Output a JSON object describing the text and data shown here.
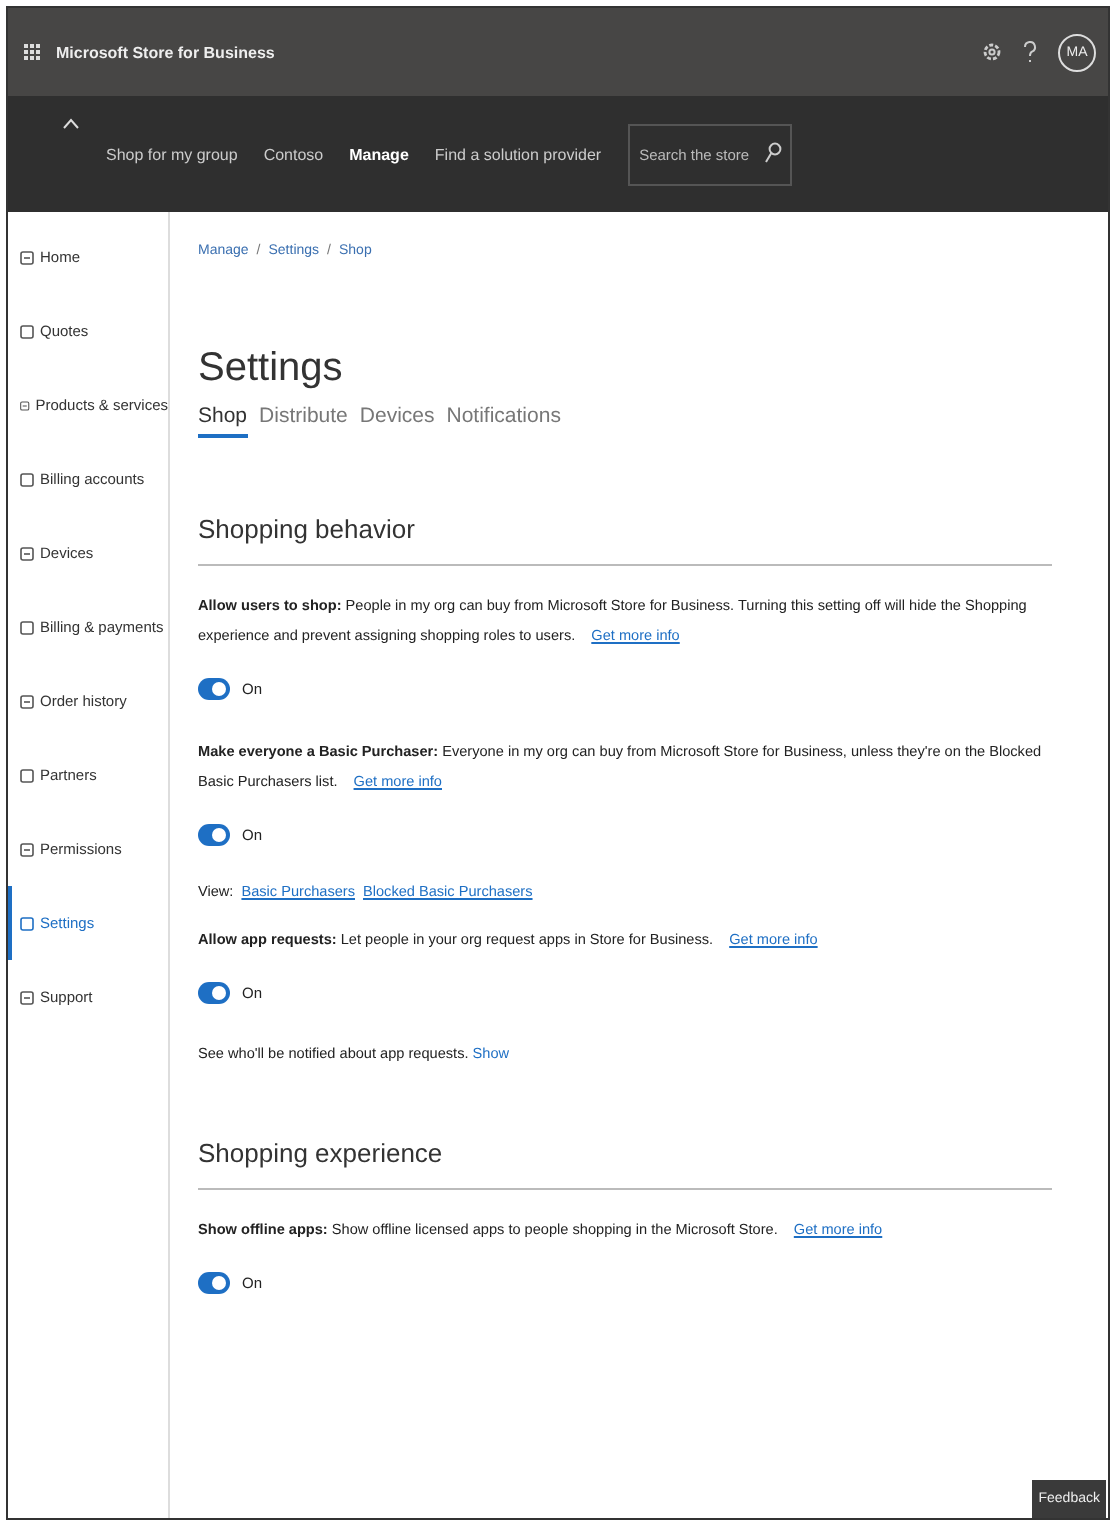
{
  "header": {
    "title": "Microsoft Store for Business",
    "avatar": "MA"
  },
  "nav": {
    "items": [
      {
        "label": "Shop for my group",
        "selected": false
      },
      {
        "label": "Contoso",
        "selected": false
      },
      {
        "label": "Manage",
        "selected": true
      },
      {
        "label": "Find a solution provider",
        "selected": false
      }
    ],
    "search": {
      "placeholder": "Search the store"
    }
  },
  "sidebar": {
    "items": [
      {
        "label": "Home",
        "selected": false
      },
      {
        "label": "Quotes",
        "selected": false
      },
      {
        "label": "Products & services",
        "selected": false
      },
      {
        "label": "Billing accounts",
        "selected": false
      },
      {
        "label": "Devices",
        "selected": false
      },
      {
        "label": "Billing & payments",
        "selected": false
      },
      {
        "label": "Order history",
        "selected": false
      },
      {
        "label": "Partners",
        "selected": false
      },
      {
        "label": "Permissions",
        "selected": false
      },
      {
        "label": "Settings",
        "selected": true
      },
      {
        "label": "Support",
        "selected": false
      }
    ]
  },
  "breadcrumb": {
    "separator": "/",
    "items": [
      "Manage",
      "Settings",
      "Shop"
    ]
  },
  "title": "Settings",
  "tabs": [
    {
      "label": "Shop",
      "selected": true
    },
    {
      "label": "Distribute",
      "selected": false
    },
    {
      "label": "Devices",
      "selected": false
    },
    {
      "label": "Notifications",
      "selected": false
    }
  ],
  "sections": [
    {
      "heading": "Shopping behavior",
      "items": [
        {
          "kind": "setting",
          "label": "Allow users to shop:",
          "text": "People in my org can buy from Microsoft Store for Business. Turning this setting off will hide the Shopping experience and prevent assigning shopping roles to users.",
          "link": "Get more info",
          "toggle": {
            "on": true,
            "label": "On"
          }
        },
        {
          "kind": "setting",
          "label": "Make everyone a Basic Purchaser:",
          "text": "Everyone in my org can buy from Microsoft Store for Business, unless they're on the Blocked Basic Purchasers list.",
          "link": "Get more info",
          "toggle": {
            "on": true,
            "label": "On"
          }
        },
        {
          "kind": "links",
          "text": "View:",
          "links": [
            "Basic Purchasers",
            "Blocked Basic Purchasers"
          ]
        },
        {
          "kind": "setting",
          "label": "Allow app requests:",
          "text": "Let people in your org request apps in Store for Business.",
          "link": "Get more info",
          "toggle": {
            "on": true,
            "label": "On"
          }
        },
        {
          "kind": "note",
          "text": "See who'll be notified about app requests.",
          "link": "Show"
        }
      ]
    },
    {
      "heading": "Shopping experience",
      "items": [
        {
          "kind": "setting",
          "label": "Show offline apps:",
          "text": "Show offline licensed apps to people shopping in the Microsoft Store.",
          "link": "Get more info",
          "toggle": {
            "on": true,
            "label": "On"
          }
        }
      ]
    }
  ],
  "feedback": "Feedback"
}
